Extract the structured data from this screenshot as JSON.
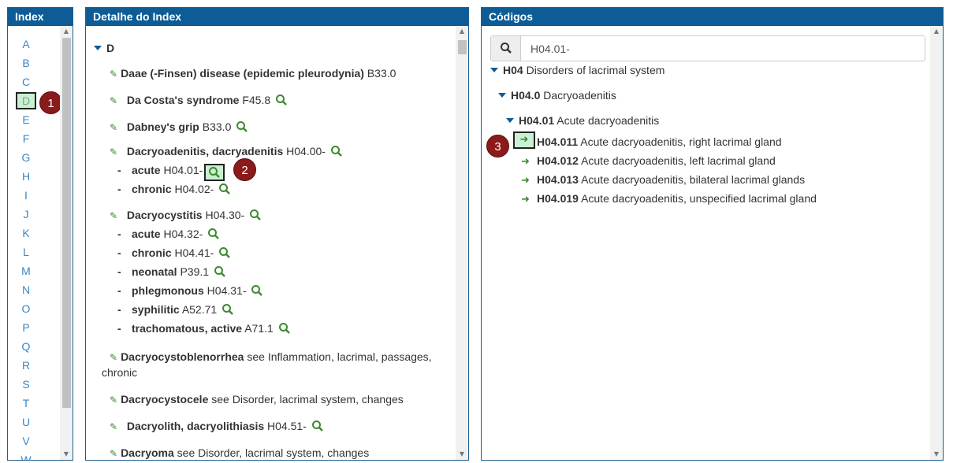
{
  "index_panel": {
    "title": "Index",
    "letters": [
      "A",
      "B",
      "C",
      "D",
      "E",
      "F",
      "G",
      "H",
      "I",
      "J",
      "K",
      "L",
      "M",
      "N",
      "O",
      "P",
      "Q",
      "R",
      "S",
      "T",
      "U",
      "V",
      "W"
    ],
    "selected": "D",
    "badge": "1"
  },
  "detail_panel": {
    "title": "Detalhe do Index",
    "section": "D",
    "badge": "2",
    "entries": [
      {
        "term": "Daae (-Finsen) disease (epidemic pleurodynia)",
        "code": "B33.0"
      },
      {
        "term": "Da Costa's syndrome",
        "code": "F45.8"
      },
      {
        "term": "Dabney's grip",
        "code": "B33.0"
      },
      {
        "term": "Dacryoadenitis, dacryadenitis",
        "code": "H04.00-"
      },
      {
        "term": "acute",
        "code": "H04.01-"
      },
      {
        "term": "chronic",
        "code": "H04.02-"
      },
      {
        "term": "Dacryocystitis",
        "code": "H04.30-"
      },
      {
        "term": "acute",
        "code": "H04.32-"
      },
      {
        "term": "chronic",
        "code": "H04.41-"
      },
      {
        "term": "neonatal",
        "code": "P39.1"
      },
      {
        "term": "phlegmonous",
        "code": "H04.31-"
      },
      {
        "term": "syphilitic",
        "code": "A52.71"
      },
      {
        "term": "trachomatous, active",
        "code": "A71.1"
      },
      {
        "term": "Dacryocystoblenorrhea",
        "see": "see Inflammation, lacrimal, passages,",
        "see2": "chronic"
      },
      {
        "term": "Dacryocystocele",
        "see": "see Disorder, lacrimal system, changes"
      },
      {
        "term": "Dacryolith, dacryolithiasis",
        "code": "H04.51-"
      },
      {
        "term": "Dacryoma",
        "see": "see Disorder, lacrimal system, changes"
      }
    ]
  },
  "codes_panel": {
    "title": "Códigos",
    "search_value": "H04.01-",
    "badge": "3",
    "tree": [
      {
        "code": "H04",
        "desc": "Disorders of lacrimal system"
      },
      {
        "code": "H04.0",
        "desc": "Dacryoadenitis"
      },
      {
        "code": "H04.01",
        "desc": "Acute dacryoadenitis"
      },
      {
        "code": "H04.011",
        "desc": "Acute dacryoadenitis, right lacrimal gland"
      },
      {
        "code": "H04.012",
        "desc": "Acute dacryoadenitis, left lacrimal gland"
      },
      {
        "code": "H04.013",
        "desc": "Acute dacryoadenitis, bilateral lacrimal glands"
      },
      {
        "code": "H04.019",
        "desc": "Acute dacryoadenitis, unspecified lacrimal gland"
      }
    ]
  },
  "colors": {
    "header": "#0e5c95",
    "accent_green": "#3c8a2e",
    "link_blue": "#3a86c8",
    "badge": "#8b1a1a",
    "highlight": "#c9f0d2"
  }
}
